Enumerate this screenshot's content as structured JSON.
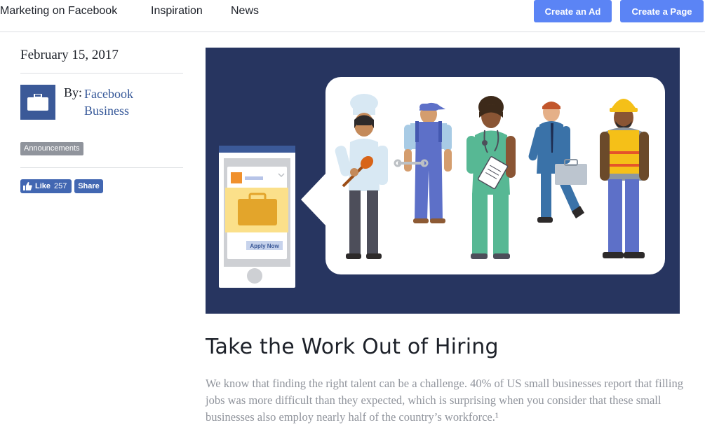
{
  "nav": {
    "links": [
      "Marketing on Facebook",
      "Inspiration",
      "News"
    ],
    "create_ad": "Create an Ad",
    "create_page": "Create a Page"
  },
  "sidebar": {
    "date": "February 15, 2017",
    "by_label": "By:",
    "author": "Facebook Business",
    "tag": "Announcements",
    "like_label": "Like",
    "like_count": "257",
    "share_label": "Share"
  },
  "hero": {
    "apply_label": "Apply Now"
  },
  "article": {
    "title": "Take the Work Out of Hiring",
    "body": "We know that finding the right talent can be a challenge. 40% of US small businesses report that filling jobs was more difficult than they expected, which is surprising when you consider that these small businesses also employ nearly half of the country’s workforce.¹"
  },
  "colors": {
    "brand": "#3b5998",
    "button": "#5b84f5",
    "hero_bg": "#273560"
  }
}
